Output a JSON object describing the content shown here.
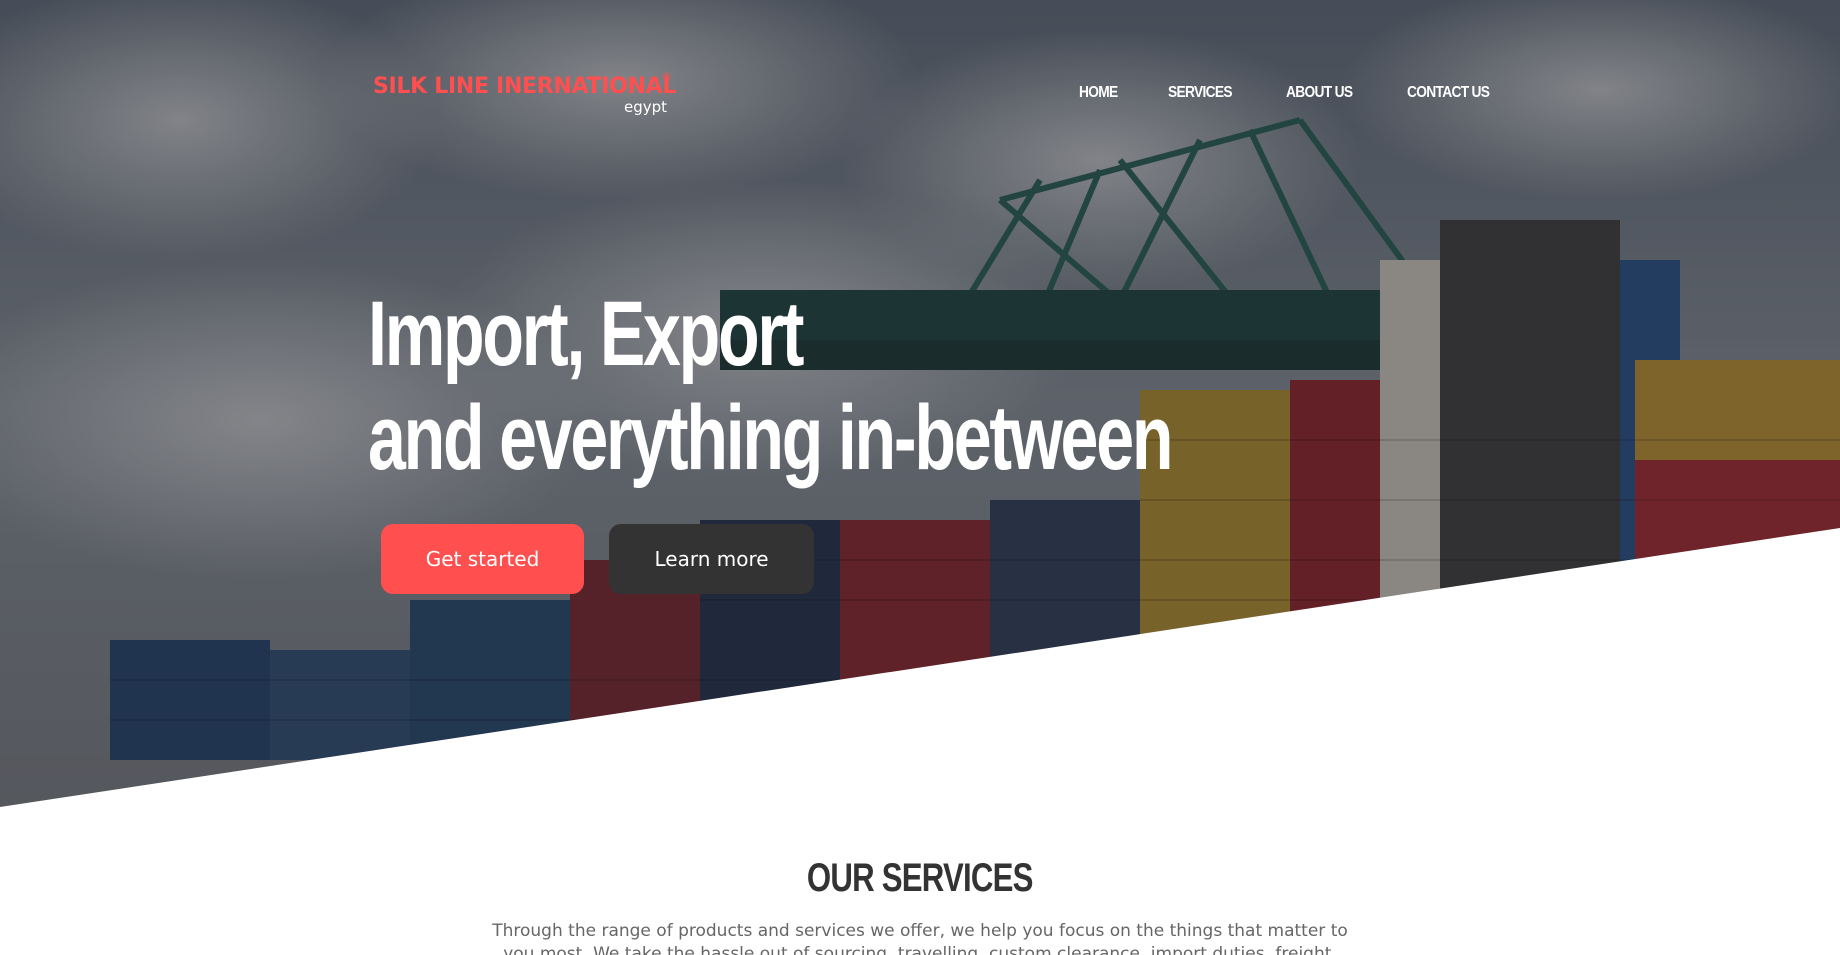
{
  "brand": {
    "name": "SILK LINE INERNATIONAL",
    "registered_mark": "®",
    "sub": "egypt",
    "color": "#ff4f4f"
  },
  "nav": {
    "items": [
      {
        "label": "HOME"
      },
      {
        "label": "SERVICES"
      },
      {
        "label": "ABOUT US"
      },
      {
        "label": "CONTACT US"
      }
    ]
  },
  "hero": {
    "line1": "Import, Export",
    "line2": "and everything in-between",
    "primary_button": "Get started",
    "secondary_button": "Learn more",
    "primary_color": "#ff4f4f",
    "secondary_color": "#333333"
  },
  "services": {
    "title": "OUR SERVICES",
    "text": "Through the range of products and services we offer, we help you focus on the things that matter to you most. We take the hassle out of sourcing, travelling, custom clearance, import duties, freight, goods"
  }
}
